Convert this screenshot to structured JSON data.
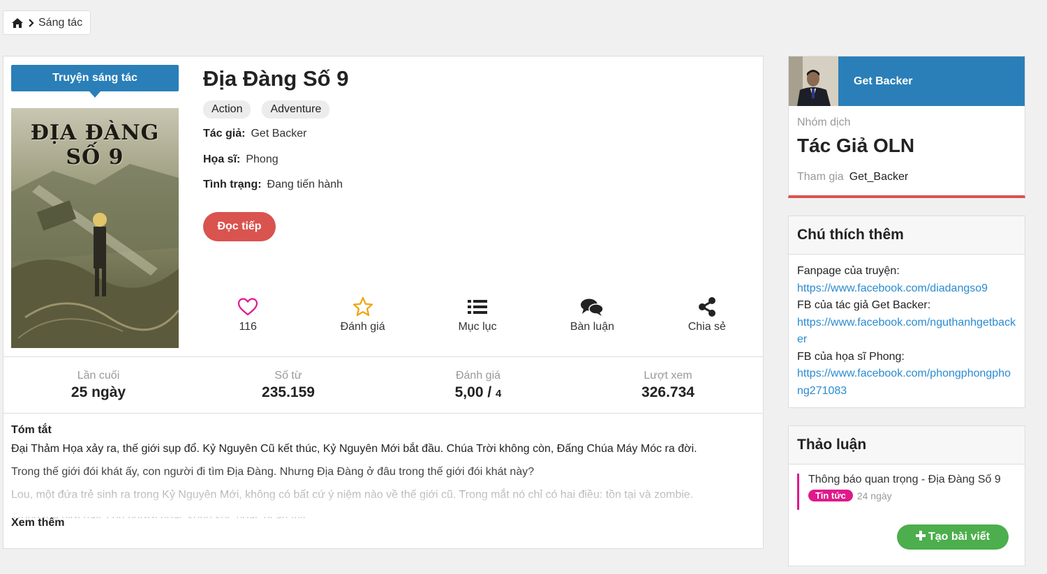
{
  "breadcrumb": {
    "icon": "home-icon",
    "separator_icon": "chevron-right-icon",
    "current": "Sáng tác"
  },
  "story": {
    "category_label": "Truyện sáng tác",
    "cover_title": "ĐỊA ĐÀNG SỐ 9",
    "title": "Địa Đàng Số 9",
    "tags": [
      "Action",
      "Adventure"
    ],
    "author_label": "Tác giả:",
    "author": "Get Backer",
    "artist_label": "Họa sĩ:",
    "artist": "Phong",
    "status_label": "Tình trạng:",
    "status": "Đang tiến hành",
    "read_button": "Đọc tiếp"
  },
  "actions": {
    "favorite": {
      "icon": "heart-icon",
      "label": "116"
    },
    "rate": {
      "icon": "star-icon",
      "label": "Đánh giá"
    },
    "toc": {
      "icon": "list-icon",
      "label": "Mục lục"
    },
    "discuss": {
      "icon": "comments-icon",
      "label": "Bàn luận"
    },
    "share": {
      "icon": "share-icon",
      "label": "Chia sẻ"
    }
  },
  "stats": {
    "last_update": {
      "label": "Lần cuối",
      "value": "25 ngày"
    },
    "word_count": {
      "label": "Số từ",
      "value": "235.159"
    },
    "rating": {
      "label": "Đánh giá",
      "value": "5,00 /",
      "count": "4"
    },
    "views": {
      "label": "Lượt xem",
      "value": "326.734"
    }
  },
  "summary": {
    "heading": "Tóm tắt",
    "paragraphs": [
      "Đại Thảm Họa xảy ra, thế giới sụp đổ. Kỷ Nguyên Cũ kết thúc, Kỷ Nguyên Mới bắt đầu. Chúa Trời không còn, Đấng Chúa Máy Móc ra đời.",
      "Trong thế giới đói khát ấy, con người đi tìm Địa Đàng. Nhưng Địa Đàng ở đâu trong thế giới đói khát này?",
      "Lou, một đứa trẻ sinh ra trong Kỷ Nguyên Mới, không có bất cứ ý niệm nào về thế giới cũ. Trong mắt nó chỉ có hai điều: tồn tại và zombie.",
      "Trong thế giới này, con người hoặc sống sót, hoặc bị ăn thịt."
    ],
    "see_more": "Xem thêm"
  },
  "author_card": {
    "name": "Get Backer",
    "group_label": "Nhóm dịch",
    "group_name": "Tác Giả OLN",
    "joined_label": "Tham gia",
    "joined_value": "Get_Backer"
  },
  "notes": {
    "heading": "Chú thích thêm",
    "fanpage_label": "Fanpage của truyện:",
    "fanpage_link": "https://www.facebook.com/diadangso9",
    "author_fb_label": "FB của tác giả Get Backer:",
    "author_fb_link": "https://www.facebook.com/nguthanhgetbacker",
    "artist_fb_label": "FB của họa sĩ Phong:",
    "artist_fb_link": "https://www.facebook.com/phongphongphong271083"
  },
  "discussion": {
    "heading": "Thảo luận",
    "post_title": "Thông báo quan trọng - Địa Đàng Số 9",
    "post_badge": "Tin tức",
    "post_time": "24 ngày",
    "new_post_button": "Tạo bài viết"
  },
  "colors": {
    "primary": "#2a7fb8",
    "danger": "#d9534f",
    "success": "#4cae4c",
    "pink": "#e0198a",
    "link": "#2a8bd0",
    "star": "#f0a30a"
  }
}
